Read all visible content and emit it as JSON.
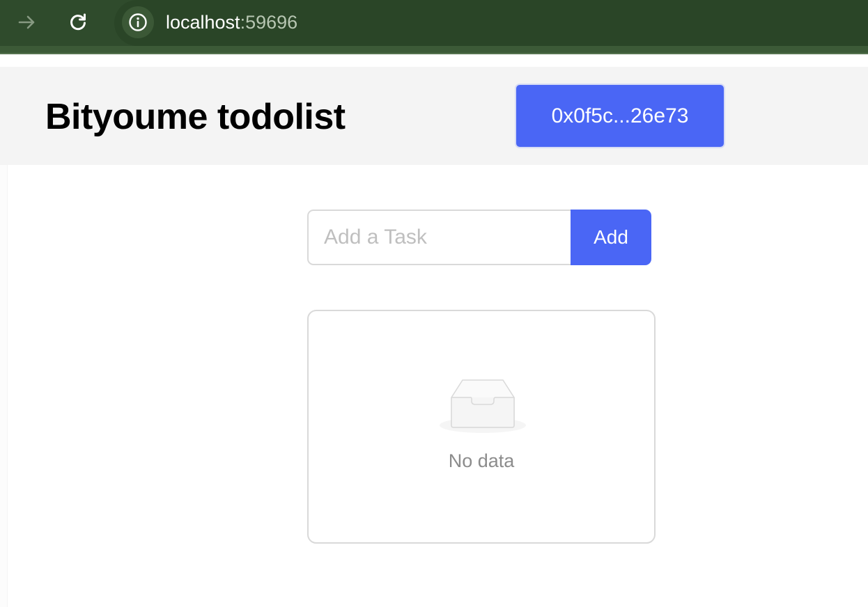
{
  "browser": {
    "url_host": "localhost",
    "url_port": ":59696"
  },
  "header": {
    "title": "Bityoume todolist",
    "wallet_address": "0x0f5c...26e73",
    "colors": {
      "background": "#f4f4f4",
      "accent": "#4a66f5"
    }
  },
  "task_form": {
    "input_value": "",
    "input_placeholder": "Add a Task",
    "add_label": "Add"
  },
  "task_list": {
    "items": [],
    "empty_text": "No data",
    "empty_icon": "empty-inbox-icon"
  },
  "icons": {
    "forward": "forward-arrow-icon",
    "reload": "reload-icon",
    "site_info": "info-icon"
  }
}
